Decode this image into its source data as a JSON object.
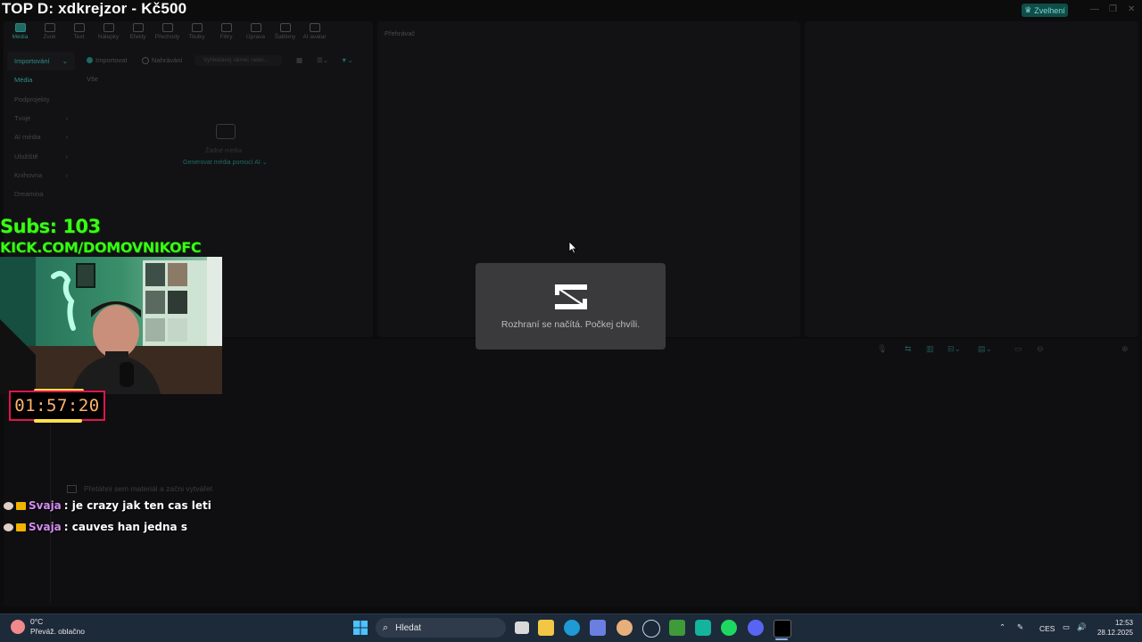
{
  "stream": {
    "title": "TOP D: xdkrejzor - Kč500",
    "subs": "Subs: 103",
    "channel": "KICK.COM/DOMOVNIKOFC",
    "timer": "01:57:20"
  },
  "capcut": {
    "top_button": "Zvelhení",
    "toolbar": [
      {
        "label": "Média",
        "icon": "media-icon",
        "active": true
      },
      {
        "label": "Zvuk",
        "icon": "audio-icon"
      },
      {
        "label": "Text",
        "icon": "text-icon"
      },
      {
        "label": "Nálepky",
        "icon": "sticker-icon"
      },
      {
        "label": "Efekty",
        "icon": "effects-icon"
      },
      {
        "label": "Přechody",
        "icon": "transition-icon"
      },
      {
        "label": "Titulky",
        "icon": "captions-icon"
      },
      {
        "label": "Filtry",
        "icon": "filter-icon"
      },
      {
        "label": "Úprava",
        "icon": "adjust-icon"
      },
      {
        "label": "Šablony",
        "icon": "templates-icon"
      },
      {
        "label": "AI avatar",
        "icon": "avatar-icon"
      }
    ],
    "sidebar": [
      {
        "label": "Importování",
        "arrow": "⌄"
      },
      {
        "label": "Média",
        "arrow": ""
      },
      {
        "label": "Podprojekty",
        "arrow": ""
      },
      {
        "label": "Tvoje",
        "arrow": "›"
      },
      {
        "label": "AI média",
        "arrow": "›"
      },
      {
        "label": "Uložiště",
        "arrow": "›"
      },
      {
        "label": "Knihovna",
        "arrow": "›"
      },
      {
        "label": "Dreamina",
        "arrow": ""
      }
    ],
    "media": {
      "import_label": "Importovat",
      "record_label": "Nahrávání",
      "search_placeholder": "Vyhledávej rámec nebo...",
      "filter_all": "Vše",
      "empty_label": "Žádné média",
      "generate_label": "Generovat média pomocí AI ⌄"
    },
    "player_title": "Přehrávač",
    "timeline_hint": "Přetáhni sem materiál a začni vytvářet",
    "loading_message": "Rozhraní se načítá. Počkej chvíli."
  },
  "chat": [
    {
      "user": "Svaja",
      "message": ": je crazy jak ten cas leti"
    },
    {
      "user": "Svaja",
      "message": ": cauves han jedna s"
    }
  ],
  "taskbar": {
    "temperature": "0°C",
    "weather": "Převáž. oblačno",
    "search_placeholder": "Hledat",
    "language": "CES",
    "time": "12:53",
    "date": "28.12.2025"
  },
  "colors": {
    "accent": "#39ff14",
    "timer_border": "#e0144e",
    "timer_text": "#ffb36b",
    "chat_user": "#d58cf0",
    "capcut_accent": "#2c8c83",
    "taskbar": "#1d2a3a"
  }
}
